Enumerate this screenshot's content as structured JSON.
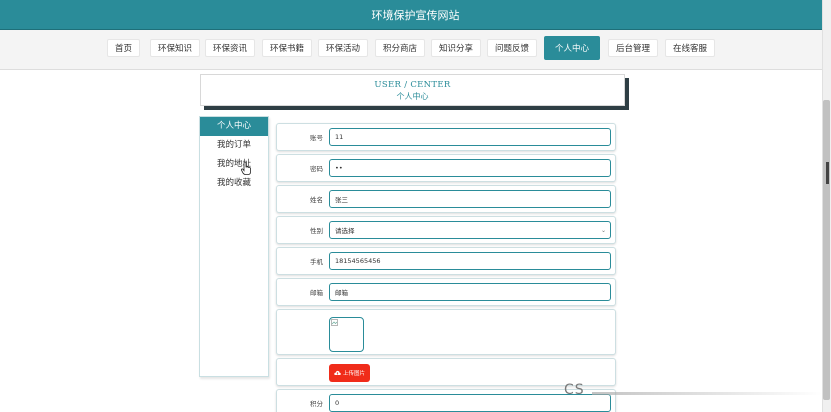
{
  "site": {
    "title": "环境保护宣传网站"
  },
  "nav": {
    "items": [
      {
        "label": "首页"
      },
      {
        "label": "环保知识"
      },
      {
        "label": "环保资讯"
      },
      {
        "label": "环保书籍"
      },
      {
        "label": "环保活动"
      },
      {
        "label": "积分商店"
      },
      {
        "label": "知识分享"
      },
      {
        "label": "问题反馈"
      },
      {
        "label": "个人中心",
        "active": true
      },
      {
        "label": "后台管理"
      },
      {
        "label": "在线客服"
      }
    ]
  },
  "header": {
    "title_en": "USER / CENTER",
    "title_zh": "个人中心"
  },
  "side_menu": {
    "items": [
      {
        "label": "个人中心",
        "active": true
      },
      {
        "label": "我的订单"
      },
      {
        "label": "我的地址"
      },
      {
        "label": "我的收藏"
      }
    ]
  },
  "form": {
    "account": {
      "label": "账号",
      "value": "11"
    },
    "password": {
      "label": "密码",
      "value": "••"
    },
    "name": {
      "label": "姓名",
      "value": "张三"
    },
    "gender": {
      "label": "性别",
      "value": "请选择"
    },
    "phone": {
      "label": "手机",
      "value": "18154565456"
    },
    "email": {
      "label": "邮箱",
      "value": "邮箱"
    },
    "upload_button": {
      "label": "上传图片"
    },
    "points": {
      "label": "积分",
      "value": "0"
    }
  },
  "watermark": {
    "text": "CS"
  },
  "colors": {
    "accent": "#2a8c99",
    "upload": "#f02c1a",
    "header_shadow": "#2e3e44"
  }
}
